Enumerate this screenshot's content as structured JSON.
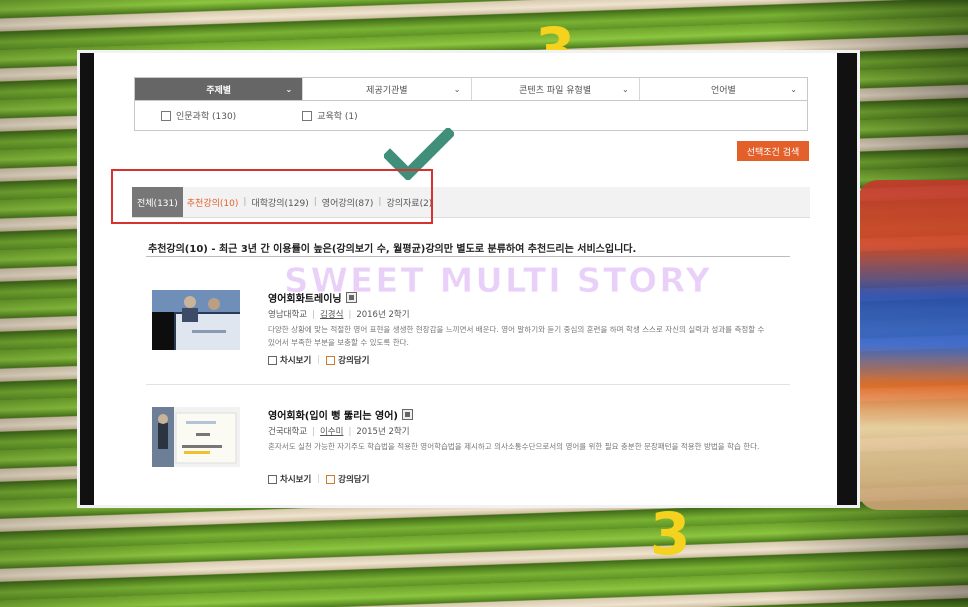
{
  "filters": [
    {
      "label": "주제별",
      "active": true
    },
    {
      "label": "제공기관별",
      "active": false
    },
    {
      "label": "콘텐츠 파일 유형별",
      "active": false
    },
    {
      "label": "언어별",
      "active": false
    }
  ],
  "checkboxes": [
    {
      "label": "인문과학 (130)"
    },
    {
      "label": "교육학 (1)"
    }
  ],
  "search_button": "선택조건 검색",
  "tabs": {
    "all": "전체(131)",
    "recommended": "추천강의(10)",
    "university": "대학강의(129)",
    "english": "영어강의(87)",
    "materials": "강의자료(2)"
  },
  "description": "추천강의(10) - 최근 3년 간 이용률이 높은(강의보기 수, 월평균)강의만 별도로 분류하여 추천드리는 서비스입니다.",
  "watermark": "SWEET MULTI STORY",
  "courses": [
    {
      "title": "영어회화트레이닝",
      "school": "영남대학교",
      "professor": "김경식",
      "term": "2016년 2학기",
      "summary": "다양한 상황에 맞는 적절한 영어 표현을 생생한 현장감을 느끼면서 배운다. 영어 말하기와 듣기 중심의 훈련을 하며 학생 스스로 자신의 실력과 성과를 측정할 수 있어서 부족한 부분을 보충할 수 있도록 한다.",
      "action_view": "차시보기",
      "action_add": "강의담기"
    },
    {
      "title": "영어회화(입이 뻥 뚫리는 영어)",
      "school": "건국대학교",
      "professor": "이수미",
      "term": "2015년 2학기",
      "summary": "혼자서도 실천 가능한 자기주도 학습법을 적용한 영어학습법을 제시하고 의사소통수단으로서의 영어를 위한 필요 충분한 문장패턴을 적용한 방법을 학습 한다.",
      "action_view": "차시보기",
      "action_add": "강의담기"
    }
  ],
  "colors": {
    "accent_orange": "#e4602b",
    "highlight_red": "#d73232",
    "check_green": "#3f8f7a"
  }
}
